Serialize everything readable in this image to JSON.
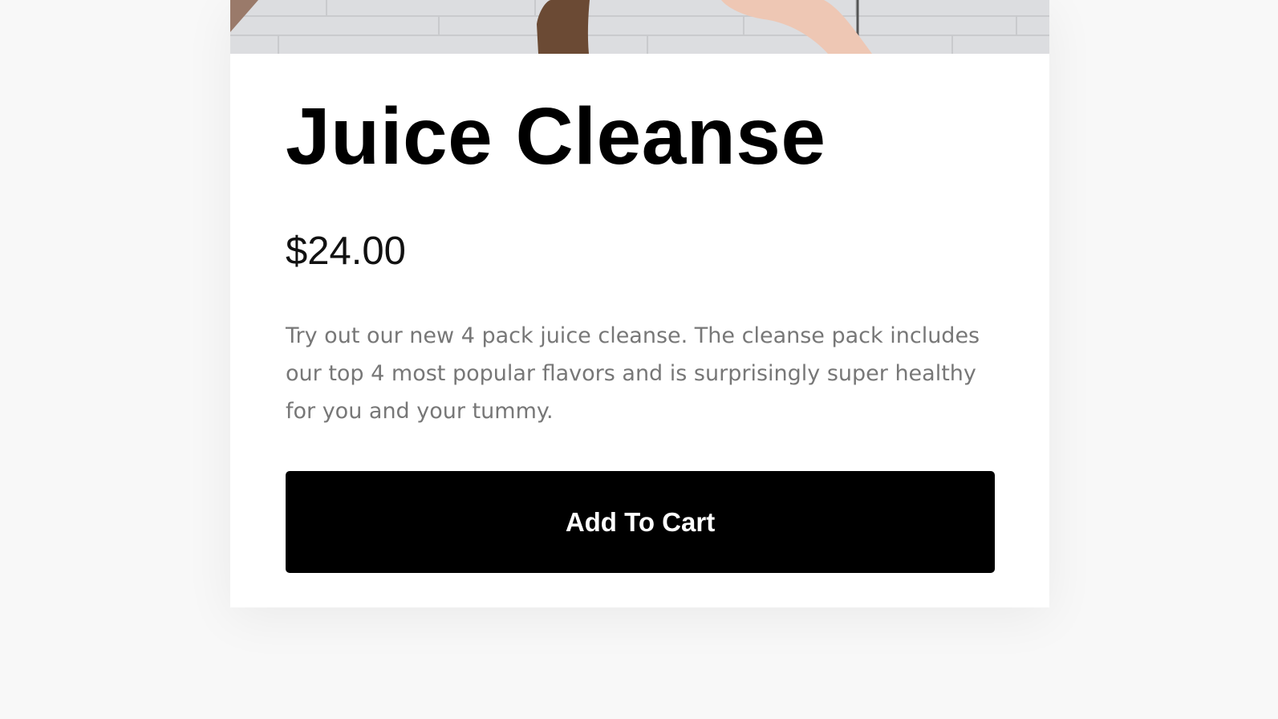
{
  "product": {
    "title": "Juice Cleanse",
    "price": "$24.00",
    "description": "Try out our new 4 pack juice cleanse. The cleanse pack includes our top 4 most popular flavors and is surprisingly super healthy for you and your tummy.",
    "add_to_cart_label": "Add To Cart"
  },
  "colors": {
    "page_background": "#f8f8f8",
    "card_background": "#ffffff",
    "button_background": "#000000",
    "button_text": "#ffffff",
    "description_text": "#777777"
  }
}
